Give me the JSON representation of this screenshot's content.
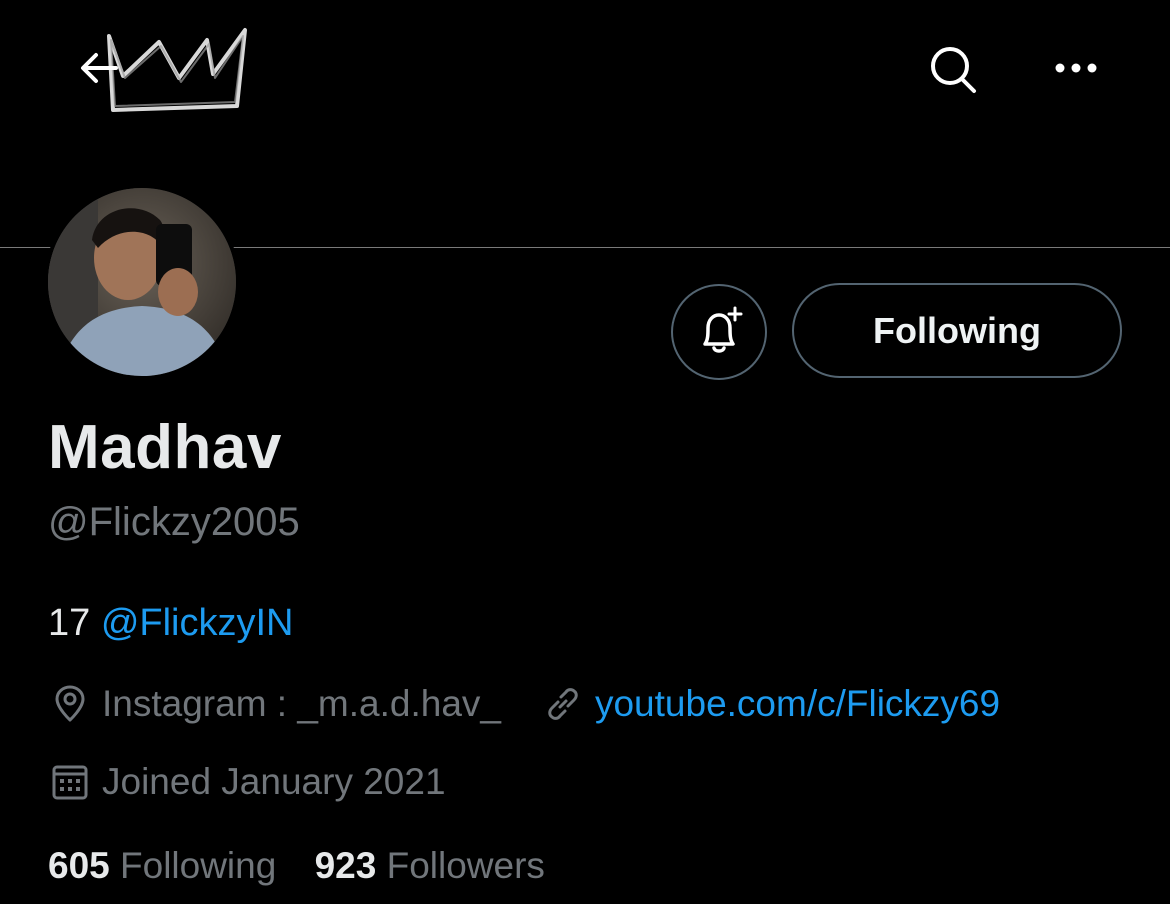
{
  "header": {
    "back_icon": "arrow-left-icon",
    "search_icon": "search-icon",
    "more_icon": "ellipsis-icon",
    "banner_art": "crown-doodle"
  },
  "profile": {
    "display_name": "Madhav",
    "username": "@Flickzy2005",
    "bio_text": "17 ",
    "bio_mention": "@FlickzyIN",
    "location": "Instagram :  _m.a.d.hav_",
    "website": "youtube.com/c/Flickzy69",
    "joined": "Joined January 2021"
  },
  "actions": {
    "notify_icon": "bell-plus-icon",
    "follow_label": "Following"
  },
  "stats": {
    "following_count": "605",
    "following_label": "Following",
    "followers_count": "923",
    "followers_label": "Followers"
  },
  "colors": {
    "background": "#000000",
    "accent": "#1d9bf0",
    "secondary_text": "#71767b",
    "primary_text": "#e7e9ea",
    "border": "#536471"
  }
}
